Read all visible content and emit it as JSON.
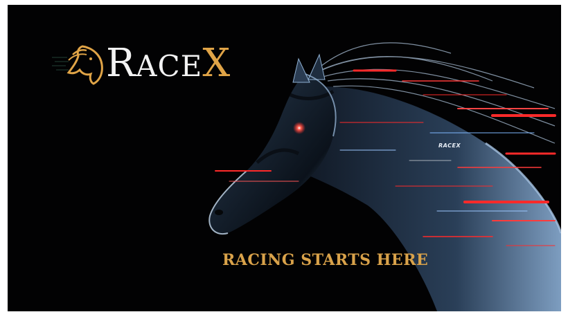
{
  "brand": {
    "name_lead": "R",
    "name_middle": "ACE",
    "name_tail": "X",
    "gold": "#e0a447",
    "icon": "horse-head-icon"
  },
  "tagline": "RACING STARTS HERE",
  "saddle_cloth_text": "RACEX",
  "colors": {
    "background": "#020203",
    "tagline": "#d9a24a",
    "horse_highlight": "#8fb0d2",
    "streak_red": "#ff2a2a"
  }
}
